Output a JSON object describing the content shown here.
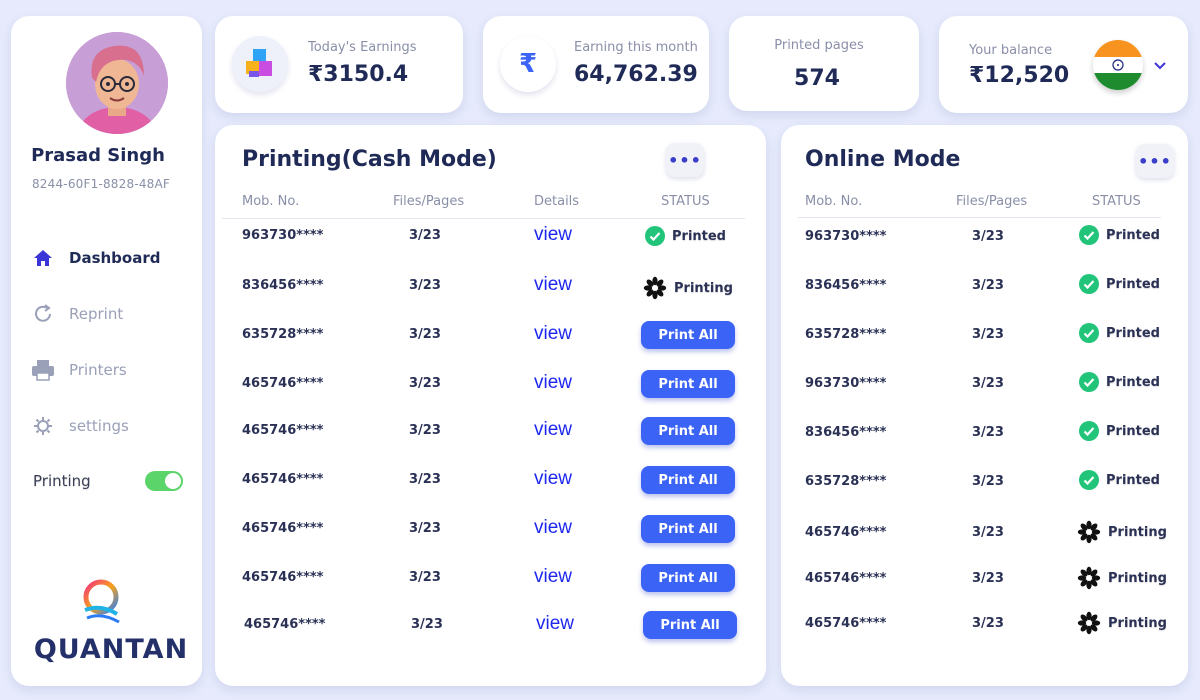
{
  "user": {
    "name": "Prasad Singh",
    "id": "8244-60F1-8828-48AF"
  },
  "nav": [
    {
      "label": "Dashboard",
      "icon": "home-icon",
      "active": true
    },
    {
      "label": "Reprint",
      "icon": "refresh-icon",
      "active": false
    },
    {
      "label": "Printers",
      "icon": "printer-icon",
      "active": false
    },
    {
      "label": "settings",
      "icon": "gear-icon",
      "active": false
    }
  ],
  "toggle": {
    "label": "Printing",
    "on": true,
    "color": "#5bd46a"
  },
  "brand": {
    "name": "QUANTAN"
  },
  "stats": {
    "today": {
      "label": "Today's Earnings",
      "value": "₹3150.4"
    },
    "month": {
      "label": "Earning this month",
      "value": "64,762.39",
      "icon_glyph": "₹"
    },
    "pages": {
      "label": "Printed pages",
      "value": "574"
    },
    "balance": {
      "label": "Your balance",
      "value": "₹12,520"
    }
  },
  "cash": {
    "title": "Printing(Cash Mode)",
    "headers": [
      "Mob. No.",
      "Files/Pages",
      "Details",
      "STATUS"
    ],
    "view_label": "view",
    "print_label": "Print All",
    "rows": [
      {
        "mob": "963730****",
        "pages": "3/23",
        "status": "Printed"
      },
      {
        "mob": "836456****",
        "pages": "3/23",
        "status": "Printing"
      },
      {
        "mob": "635728****",
        "pages": "3/23",
        "status": "Print All"
      },
      {
        "mob": "465746****",
        "pages": "3/23",
        "status": "Print All"
      },
      {
        "mob": "465746****",
        "pages": "3/23",
        "status": "Print All"
      },
      {
        "mob": "465746****",
        "pages": "3/23",
        "status": "Print All"
      },
      {
        "mob": "465746****",
        "pages": "3/23",
        "status": "Print All"
      },
      {
        "mob": "465746****",
        "pages": "3/23",
        "status": "Print All"
      },
      {
        "mob": "465746****",
        "pages": "3/23",
        "status": "Print All"
      }
    ]
  },
  "online": {
    "title": "Online Mode",
    "headers": [
      "Mob. No.",
      "Files/Pages",
      "STATUS"
    ],
    "rows": [
      {
        "mob": "963730****",
        "pages": "3/23",
        "status": "Printed"
      },
      {
        "mob": "836456****",
        "pages": "3/23",
        "status": "Printed"
      },
      {
        "mob": "635728****",
        "pages": "3/23",
        "status": "Printed"
      },
      {
        "mob": "963730****",
        "pages": "3/23",
        "status": "Printed"
      },
      {
        "mob": "836456****",
        "pages": "3/23",
        "status": "Printed"
      },
      {
        "mob": "635728****",
        "pages": "3/23",
        "status": "Printed"
      },
      {
        "mob": "465746****",
        "pages": "3/23",
        "status": "Printing"
      },
      {
        "mob": "465746****",
        "pages": "3/23",
        "status": "Printing"
      },
      {
        "mob": "465746****",
        "pages": "3/23",
        "status": "Printing"
      }
    ]
  },
  "colors": {
    "accent": "#3b63f5",
    "link": "#1d27ee",
    "success": "#22c47a",
    "background": "#e6eafc"
  }
}
